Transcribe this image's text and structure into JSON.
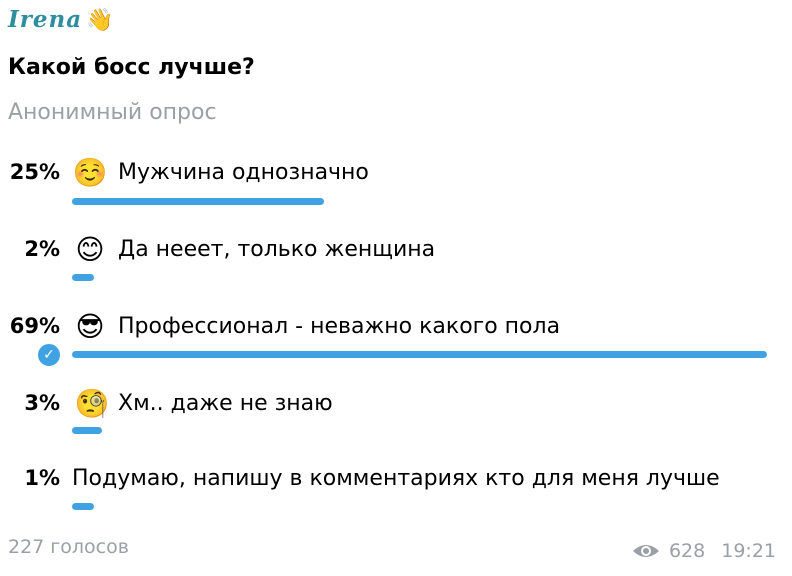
{
  "author": {
    "name": "Irena",
    "emoji": "👋"
  },
  "question": "Какой босс лучше?",
  "poll_type": "Анонимный опрос",
  "options": [
    {
      "percent_label": "25%",
      "percent": 25,
      "emoji": "☺️",
      "text": "Мужчина однозначно",
      "selected": false
    },
    {
      "percent_label": "2%",
      "percent": 2,
      "emoji": "😊",
      "text": "Да нееет, только женщина",
      "selected": false
    },
    {
      "percent_label": "69%",
      "percent": 69,
      "emoji": "😎",
      "text": "Профессионал - неважно какого пола",
      "selected": true
    },
    {
      "percent_label": "3%",
      "percent": 3,
      "emoji": "🧐",
      "text": "Хм.. даже не знаю",
      "selected": false
    },
    {
      "percent_label": "1%",
      "percent": 1,
      "emoji": "",
      "text": "Подумаю, напишу в комментариях кто для меня лучше",
      "selected": false
    }
  ],
  "footer": {
    "votes": "227 голосов",
    "views": "628",
    "time": "19:21"
  },
  "colors": {
    "accent": "#40a2e3",
    "author": "#2d8ea0",
    "muted": "#9aa0a6"
  }
}
